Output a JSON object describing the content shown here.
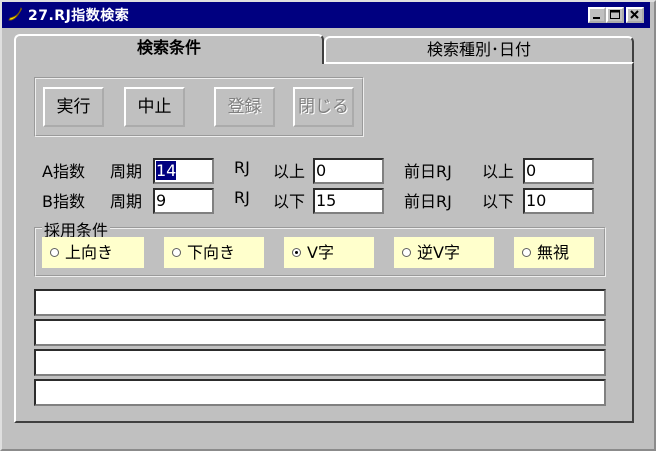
{
  "window": {
    "title": "27.RJ指数検索",
    "minimize_icon": "minimize-icon",
    "maximize_icon": "maximize-icon",
    "close_icon": "close-icon"
  },
  "tabs": [
    {
      "label": "検索条件",
      "active": true
    },
    {
      "label": "検索種別･日付",
      "active": false
    }
  ],
  "buttons": {
    "run": "実行",
    "stop": "中止",
    "register": "登録",
    "close": "閉じる"
  },
  "row_a": {
    "label": "A指数",
    "period_label": "周期",
    "period_value": "14",
    "rj_label": "RJ",
    "cond_label": "以上",
    "rj_value": "0",
    "prev_label": "前日RJ",
    "prev_cond_label": "以上",
    "prev_value": "0"
  },
  "row_b": {
    "label": "B指数",
    "period_label": "周期",
    "period_value": "9",
    "rj_label": "RJ",
    "cond_label": "以下",
    "rj_value": "15",
    "prev_label": "前日RJ",
    "prev_cond_label": "以下",
    "prev_value": "10"
  },
  "conditions": {
    "legend": "採用条件",
    "options": [
      {
        "label": "上向き",
        "selected": false
      },
      {
        "label": "下向き",
        "selected": false
      },
      {
        "label": "V字",
        "selected": true
      },
      {
        "label": "逆V字",
        "selected": false
      },
      {
        "label": "無視",
        "selected": false
      }
    ]
  },
  "results": [
    "",
    "",
    "",
    ""
  ],
  "colors": {
    "titlebar": "#000080",
    "face": "#c0c0c0",
    "radio_bg": "#ffffcc"
  }
}
